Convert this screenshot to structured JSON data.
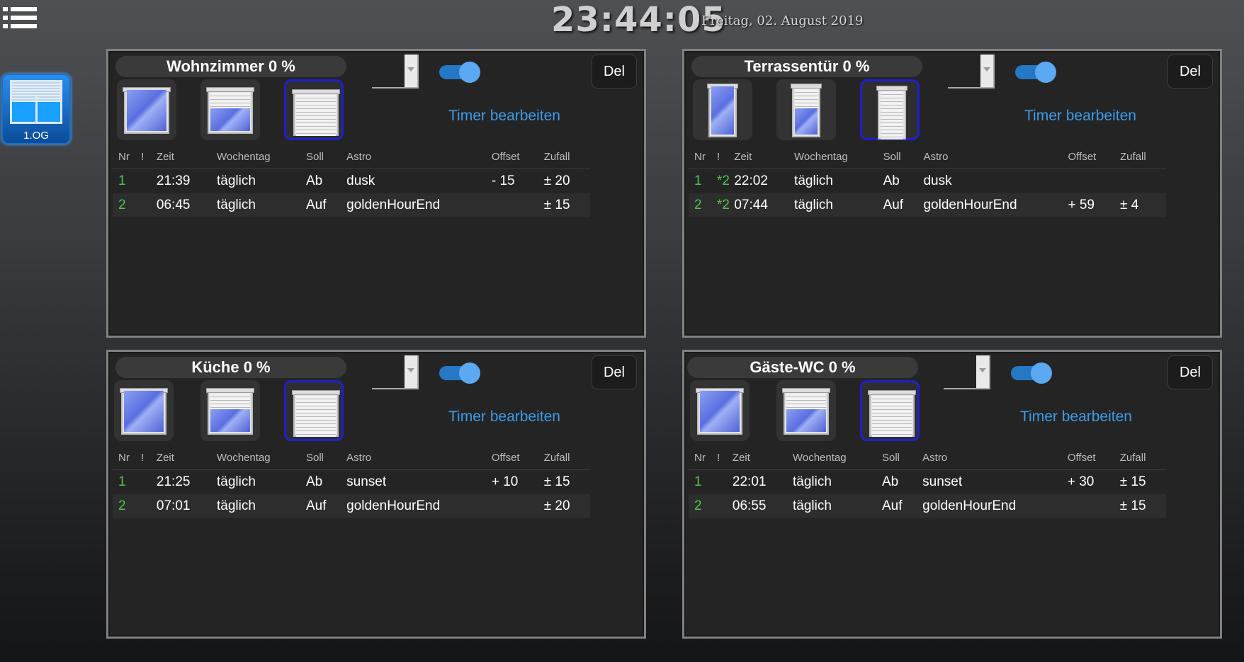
{
  "clock": {
    "time": "23:44:05",
    "date": "Freitag, 02. August 2019"
  },
  "floor": {
    "label": "1.OG"
  },
  "common": {
    "del_label": "Del",
    "timer_link": "Timer bearbeiten",
    "columns": [
      "Nr",
      "!",
      "Zeit",
      "Wochentag",
      "Soll",
      "Astro",
      "Offset",
      "Zufall"
    ]
  },
  "panels": [
    {
      "title": "Wohnzimmer 0 %",
      "toggle_on": true,
      "rows": [
        {
          "nr": "1",
          "ex": "",
          "zeit": "21:39",
          "wochentag": "täglich",
          "soll": "Ab",
          "astro": "dusk",
          "offset": "- 15",
          "zufall": "± 20"
        },
        {
          "nr": "2",
          "ex": "",
          "zeit": "06:45",
          "wochentag": "täglich",
          "soll": "Auf",
          "astro": "goldenHourEnd",
          "offset": "",
          "zufall": "± 15"
        }
      ]
    },
    {
      "title": "Terrassentür 0 %",
      "toggle_on": true,
      "rows": [
        {
          "nr": "1",
          "ex": "*2",
          "zeit": "22:02",
          "wochentag": "täglich",
          "soll": "Ab",
          "astro": "dusk",
          "offset": "",
          "zufall": ""
        },
        {
          "nr": "2",
          "ex": "*2",
          "zeit": "07:44",
          "wochentag": "täglich",
          "soll": "Auf",
          "astro": "goldenHourEnd",
          "offset": "+ 59",
          "zufall": "± 4"
        }
      ]
    },
    {
      "title": "Küche 0 %",
      "toggle_on": true,
      "rows": [
        {
          "nr": "1",
          "ex": "",
          "zeit": "21:25",
          "wochentag": "täglich",
          "soll": "Ab",
          "astro": "sunset",
          "offset": "+ 10",
          "zufall": "± 15"
        },
        {
          "nr": "2",
          "ex": "",
          "zeit": "07:01",
          "wochentag": "täglich",
          "soll": "Auf",
          "astro": "goldenHourEnd",
          "offset": "",
          "zufall": "± 20"
        }
      ]
    },
    {
      "title": "Gäste-WC 0 %",
      "toggle_on": true,
      "rows": [
        {
          "nr": "1",
          "ex": "",
          "zeit": "22:01",
          "wochentag": "täglich",
          "soll": "Ab",
          "astro": "sunset",
          "offset": "+ 30",
          "zufall": "± 15"
        },
        {
          "nr": "2",
          "ex": "",
          "zeit": "06:55",
          "wochentag": "täglich",
          "soll": "Auf",
          "astro": "goldenHourEnd",
          "offset": "",
          "zufall": "± 15"
        }
      ]
    }
  ]
}
